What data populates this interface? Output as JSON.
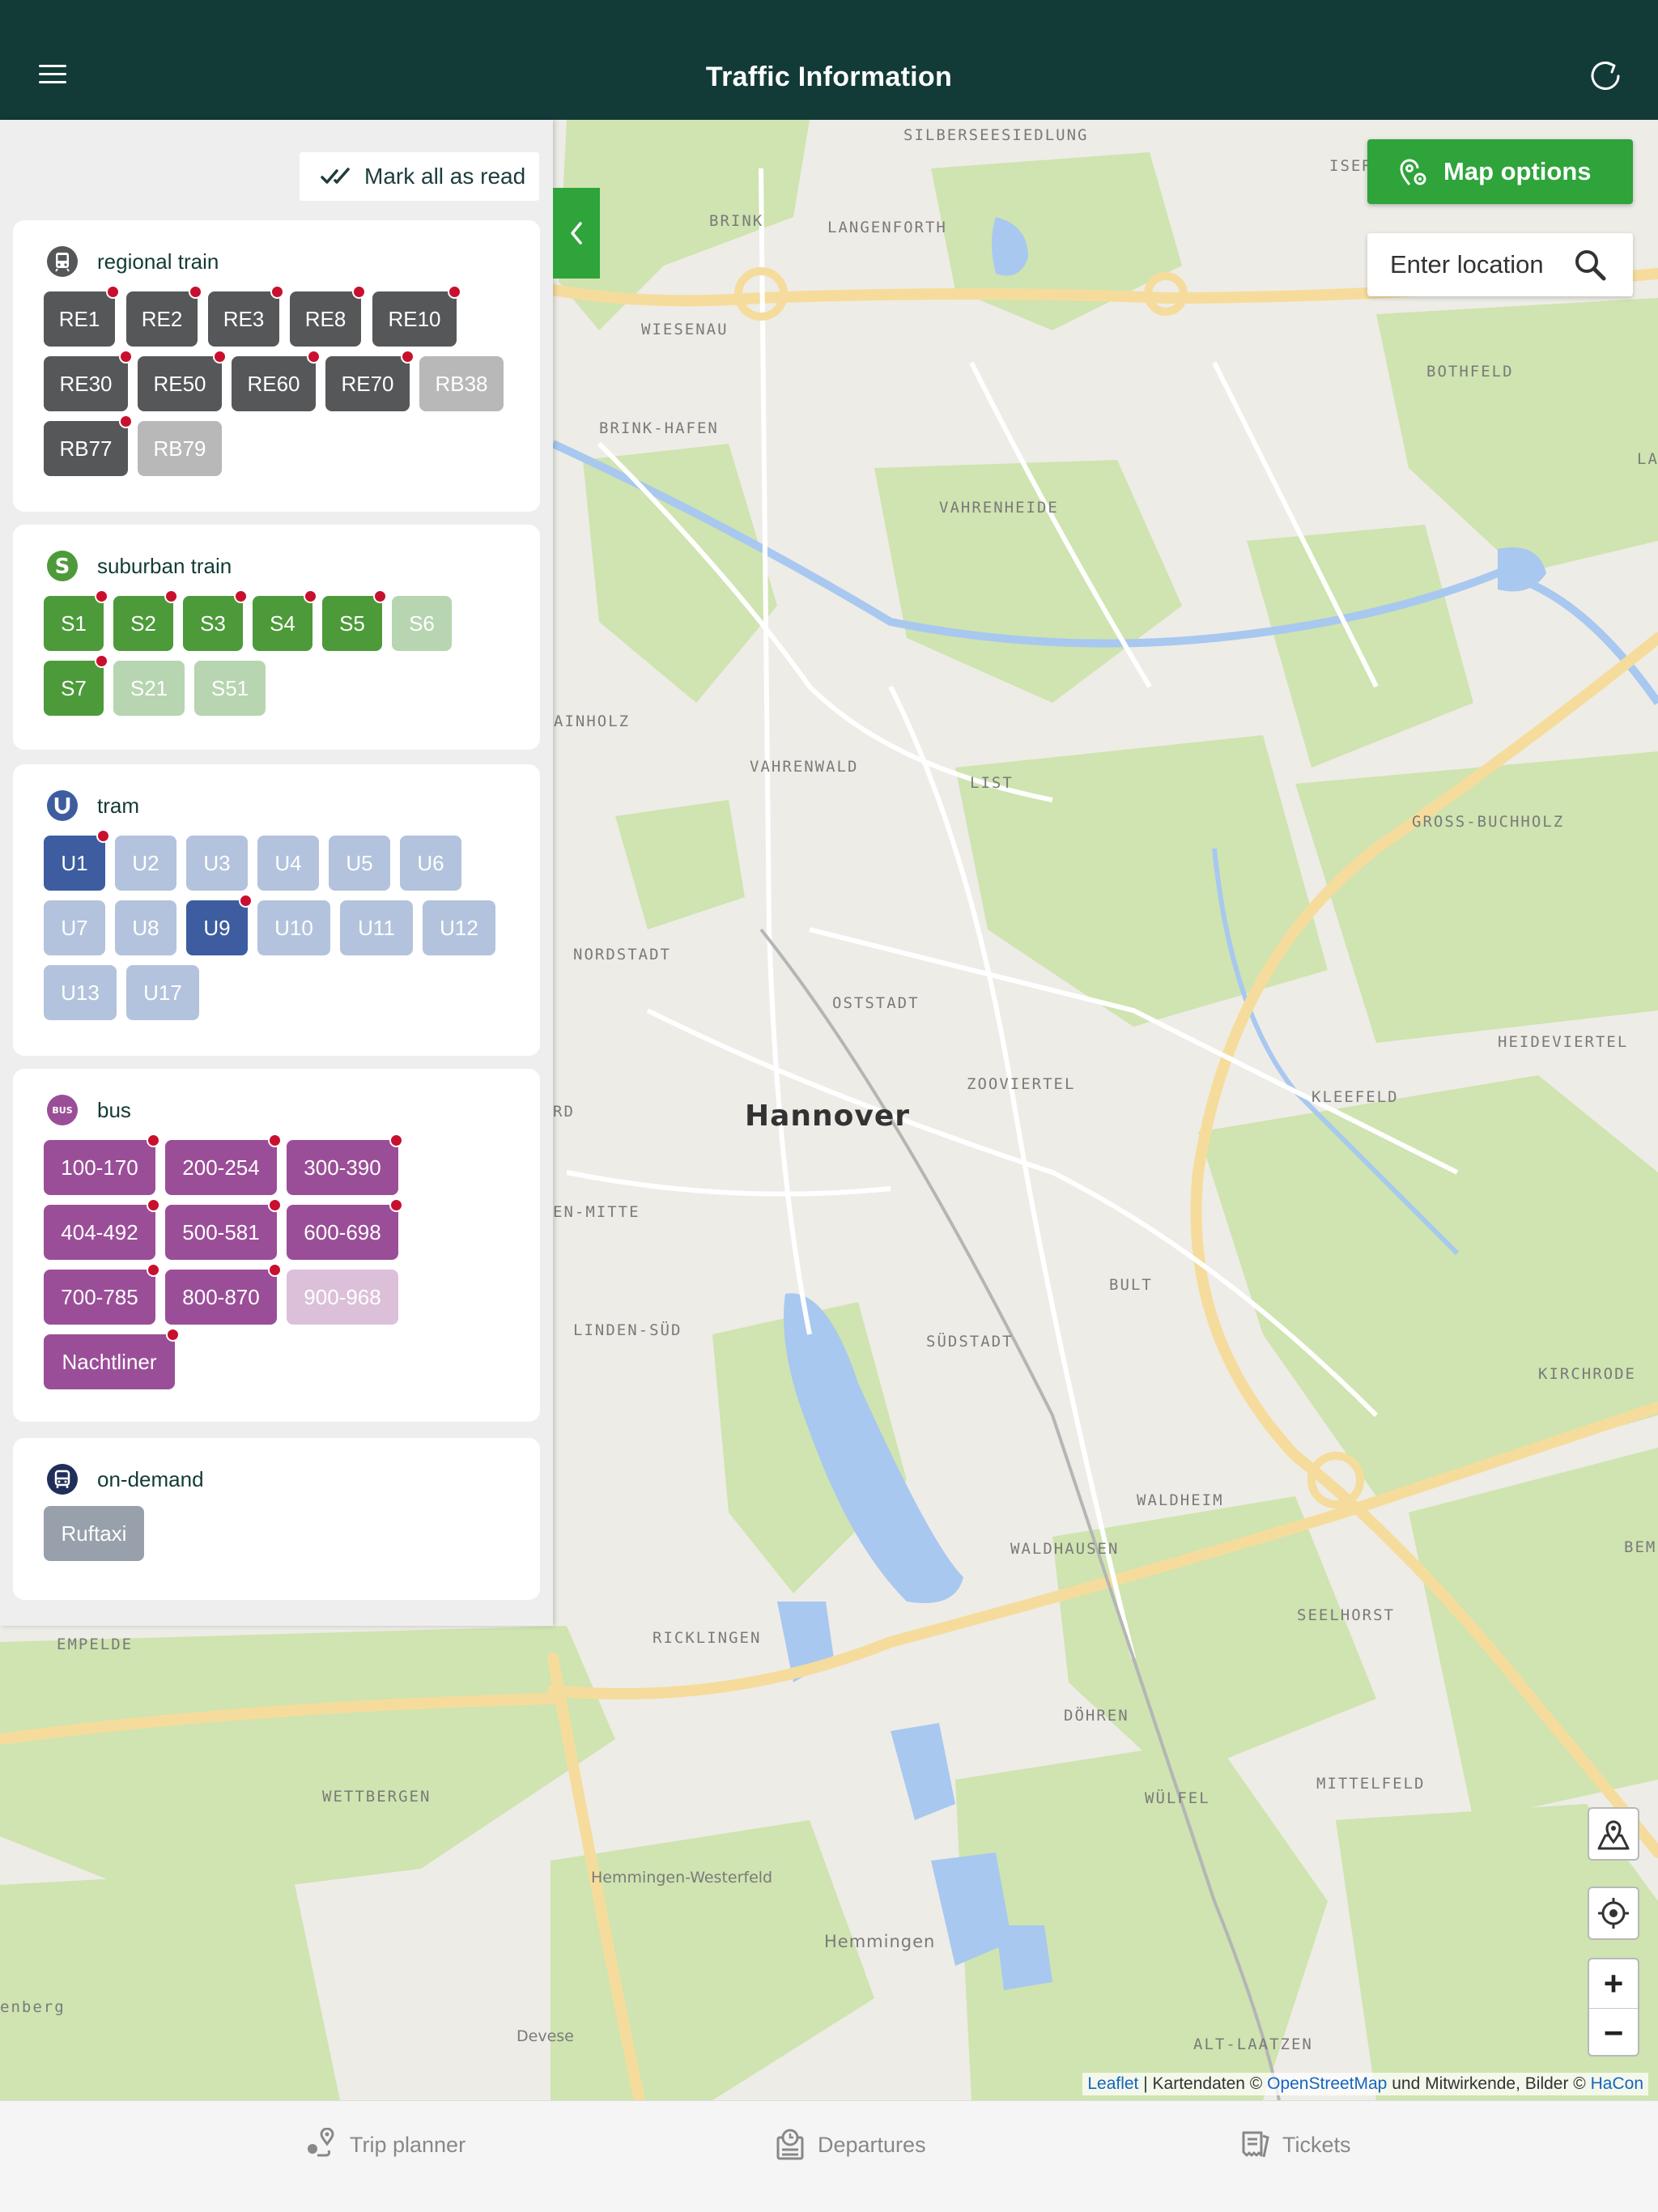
{
  "header": {
    "title": "Traffic Information"
  },
  "panel": {
    "mark_all_label": "Mark all as read",
    "categories": [
      {
        "label": "regional train",
        "icon": "train-icon",
        "lines": [
          {
            "label": "RE1",
            "active": true,
            "unread": true
          },
          {
            "label": "RE2",
            "active": true,
            "unread": true
          },
          {
            "label": "RE3",
            "active": true,
            "unread": true
          },
          {
            "label": "RE8",
            "active": true,
            "unread": true
          },
          {
            "label": "RE10",
            "active": true,
            "unread": true
          },
          {
            "label": "RE30",
            "active": true,
            "unread": true
          },
          {
            "label": "RE50",
            "active": true,
            "unread": true
          },
          {
            "label": "RE60",
            "active": true,
            "unread": true
          },
          {
            "label": "RE70",
            "active": true,
            "unread": true
          },
          {
            "label": "RB38",
            "active": false,
            "unread": false
          },
          {
            "label": "RB77",
            "active": true,
            "unread": true
          },
          {
            "label": "RB79",
            "active": false,
            "unread": false
          }
        ]
      },
      {
        "label": "suburban train",
        "icon": "s-bahn-icon",
        "lines": [
          {
            "label": "S1",
            "active": true,
            "unread": true
          },
          {
            "label": "S2",
            "active": true,
            "unread": true
          },
          {
            "label": "S3",
            "active": true,
            "unread": true
          },
          {
            "label": "S4",
            "active": true,
            "unread": true
          },
          {
            "label": "S5",
            "active": true,
            "unread": true
          },
          {
            "label": "S6",
            "active": false,
            "unread": false
          },
          {
            "label": "S7",
            "active": true,
            "unread": true
          },
          {
            "label": "S21",
            "active": false,
            "unread": false
          },
          {
            "label": "S51",
            "active": false,
            "unread": false
          }
        ]
      },
      {
        "label": "tram",
        "icon": "u-bahn-icon",
        "lines": [
          {
            "label": "U1",
            "active": true,
            "unread": true
          },
          {
            "label": "U2",
            "active": false,
            "unread": false
          },
          {
            "label": "U3",
            "active": false,
            "unread": false
          },
          {
            "label": "U4",
            "active": false,
            "unread": false
          },
          {
            "label": "U5",
            "active": false,
            "unread": false
          },
          {
            "label": "U6",
            "active": false,
            "unread": false
          },
          {
            "label": "U7",
            "active": false,
            "unread": false
          },
          {
            "label": "U8",
            "active": false,
            "unread": false
          },
          {
            "label": "U9",
            "active": true,
            "unread": true
          },
          {
            "label": "U10",
            "active": false,
            "unread": false
          },
          {
            "label": "U11",
            "active": false,
            "unread": false
          },
          {
            "label": "U12",
            "active": false,
            "unread": false
          },
          {
            "label": "U13",
            "active": false,
            "unread": false
          },
          {
            "label": "U17",
            "active": false,
            "unread": false
          }
        ]
      },
      {
        "label": "bus",
        "icon": "bus-icon",
        "icon_text": "BUS",
        "lines": [
          {
            "label": "100-170",
            "active": true,
            "unread": true
          },
          {
            "label": "200-254",
            "active": true,
            "unread": true
          },
          {
            "label": "300-390",
            "active": true,
            "unread": true
          },
          {
            "label": "404-492",
            "active": true,
            "unread": true
          },
          {
            "label": "500-581",
            "active": true,
            "unread": true
          },
          {
            "label": "600-698",
            "active": true,
            "unread": true
          },
          {
            "label": "700-785",
            "active": true,
            "unread": true
          },
          {
            "label": "800-870",
            "active": true,
            "unread": true
          },
          {
            "label": "900-968",
            "active": false,
            "unread": false
          },
          {
            "label": "Nachtliner",
            "active": true,
            "unread": true
          }
        ]
      },
      {
        "label": "on-demand",
        "icon": "on-demand-icon",
        "lines": [
          {
            "label": "Ruftaxi",
            "active": true,
            "unread": false
          }
        ]
      }
    ]
  },
  "map": {
    "options_label": "Map options",
    "location_placeholder": "Enter location",
    "city": "Hannover",
    "places": [
      "SILBERSEESIEDLUNG",
      "ISER",
      "BRINK",
      "LANGENFORTH",
      "WIESENAU",
      "BOTHFELD",
      "BRINK-HAFEN",
      "LA",
      "VAHRENHEIDE",
      "AINHOLZ",
      "VAHRENWALD",
      "LIST",
      "GROSS-BUCHHOLZ",
      "NORDSTADT",
      "OSTSTADT",
      "HEIDEVIERTEL",
      "ZOOVIERTEL",
      "KLEEFELD",
      "RD",
      "EN-MITTE",
      "BULT",
      "LINDEN-SÜD",
      "SÜDSTADT",
      "KIRCHRODE",
      "WALDHEIM",
      "WALDHAUSEN",
      "BEME",
      "SEELHORST",
      "EMPELDE",
      "RICKLINGEN",
      "DÖHREN",
      "WETTBERGEN",
      "WÜLFEL",
      "MITTELFELD",
      "Hemmingen-Westerfeld",
      "Hemmingen",
      "enberg",
      "Devese",
      "ALT-LAATZEN"
    ],
    "zoom_in": "+",
    "zoom_out": "−",
    "attribution": {
      "leaflet": "Leaflet",
      "sep1": " | Kartendaten © ",
      "osm": "OpenStreetMap",
      "sep2": " und Mitwirkende, Bilder © ",
      "hacon": "HaCon"
    }
  },
  "bottom_nav": [
    {
      "label": "Trip planner",
      "icon": "trip-planner-icon"
    },
    {
      "label": "Departures",
      "icon": "departures-icon"
    },
    {
      "label": "Tickets",
      "icon": "tickets-icon"
    }
  ]
}
